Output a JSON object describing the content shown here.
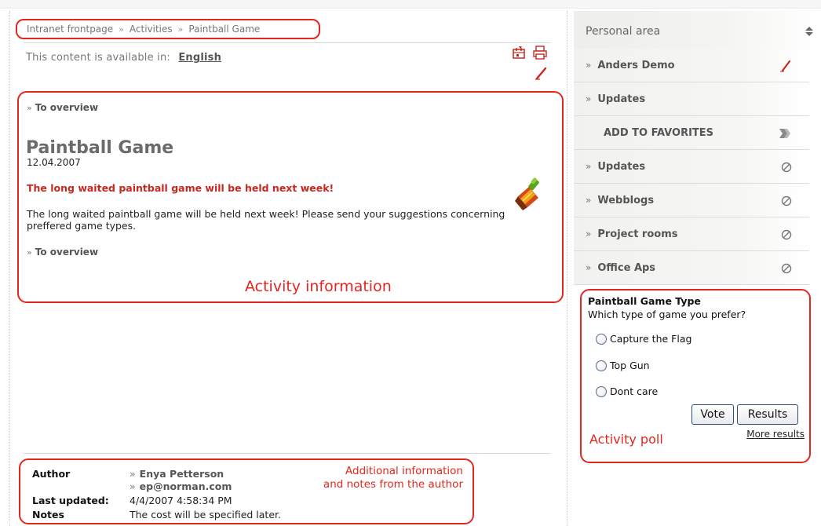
{
  "breadcrumb": {
    "items": [
      "Intranet frontpage",
      "Activities",
      "Paintball Game"
    ],
    "separator": "»"
  },
  "language": {
    "prompt": "This content is available in:",
    "link": "English"
  },
  "toolbar": {
    "icons": [
      "calendar-export-icon",
      "print-icon",
      "edit-pencil-icon"
    ]
  },
  "article": {
    "overview_link": "To overview",
    "title": "Paintball Game",
    "date": "12.04.2007",
    "lead": "The long waited paintball game will be held next week!",
    "body": "The long waited paintball game will be held next week! Please send your suggestions concerning preffered game types.",
    "icon": "paintbrush-icon",
    "annotation": "Activity information"
  },
  "author_info": {
    "author_label": "Author",
    "author_name": "Enya Petterson",
    "author_email": "ep@norman.com",
    "updated_label": "Last updated:",
    "updated_value": "4/4/2007 4:58:34 PM",
    "notes_label": "Notes",
    "notes_value": "The cost will be specified later.",
    "annotation_line1": "Additional information",
    "annotation_line2": "and notes from the author"
  },
  "sidebar": {
    "header": "Personal area",
    "header_icon": "sort-arrows-icon",
    "user": "Anders Demo",
    "items": [
      {
        "label": "Updates"
      },
      {
        "label": "ADD TO FAVORITES"
      },
      {
        "label": "Updates"
      },
      {
        "label": "Webblogs"
      },
      {
        "label": "Project rooms"
      },
      {
        "label": "Office Aps"
      }
    ]
  },
  "poll": {
    "title": "Paintball Game Type",
    "question": "Which type of game you prefer?",
    "options": [
      "Capture the Flag",
      "Top Gun",
      "Dont care"
    ],
    "vote_label": "Vote",
    "results_label": "Results",
    "more_results": "More results",
    "annotation": "Activity poll"
  },
  "colors": {
    "annotation_red": "#e4261f",
    "lead_red": "#c8271f"
  }
}
